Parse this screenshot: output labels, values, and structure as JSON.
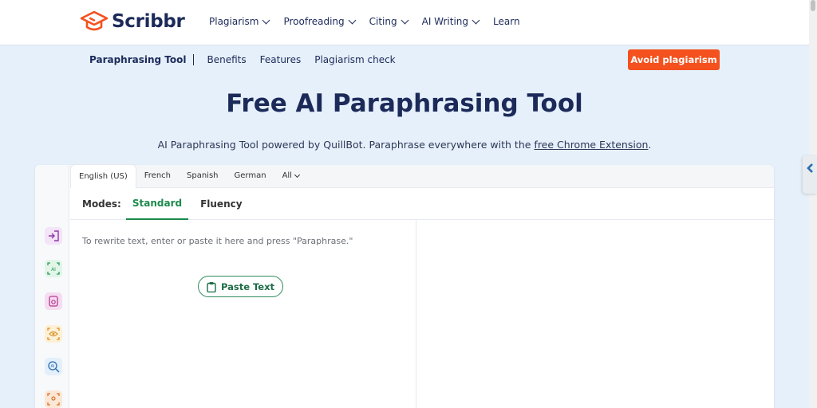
{
  "brand": {
    "name": "Scribbr",
    "accent": "#f4511e"
  },
  "nav": {
    "items": [
      {
        "label": "Plagiarism",
        "dropdown": true
      },
      {
        "label": "Proofreading",
        "dropdown": true
      },
      {
        "label": "Citing",
        "dropdown": true
      },
      {
        "label": "AI Writing",
        "dropdown": true
      },
      {
        "label": "Learn",
        "dropdown": false
      }
    ]
  },
  "subnav": {
    "current": "Paraphrasing Tool",
    "links": [
      "Benefits",
      "Features",
      "Plagiarism check"
    ],
    "cta": "Avoid plagiarism"
  },
  "hero": {
    "title": "Free AI Paraphrasing Tool",
    "subtitle_prefix": "AI Paraphrasing Tool powered by QuillBot. Paraphrase everywhere with the ",
    "subtitle_link": "free Chrome Extension",
    "subtitle_suffix": "."
  },
  "tool": {
    "languages": [
      "English (US)",
      "French",
      "Spanish",
      "German",
      "All"
    ],
    "active_language": "English (US)",
    "modes_label": "Modes:",
    "modes": [
      "Standard",
      "Fluency"
    ],
    "active_mode": "Standard",
    "input_placeholder": "To rewrite text, enter or paste it here and press \"Paraphrase.\"",
    "paste_button": "Paste Text",
    "rail_icons": [
      "paraphraser-icon",
      "ai-detector-icon",
      "plagiarism-checker-icon",
      "proofreader-icon",
      "ai-search-icon",
      "scan-icon"
    ]
  },
  "colors": {
    "navy": "#1c2a5a",
    "green": "#1b8a4b",
    "page_bg": "#e6f0fb"
  }
}
